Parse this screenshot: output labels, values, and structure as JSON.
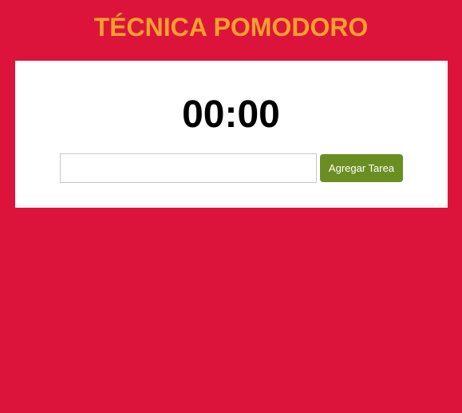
{
  "header": {
    "title": "TÉCNICA POMODORO"
  },
  "timer": {
    "display": "00:00"
  },
  "task_form": {
    "input_value": "",
    "input_placeholder": "",
    "add_button_label": "Agregar Tarea"
  },
  "colors": {
    "background": "#DC143C",
    "title": "#F7A12A",
    "card": "#FFFFFF",
    "button": "#6B8E23",
    "timer_text": "#000000"
  }
}
